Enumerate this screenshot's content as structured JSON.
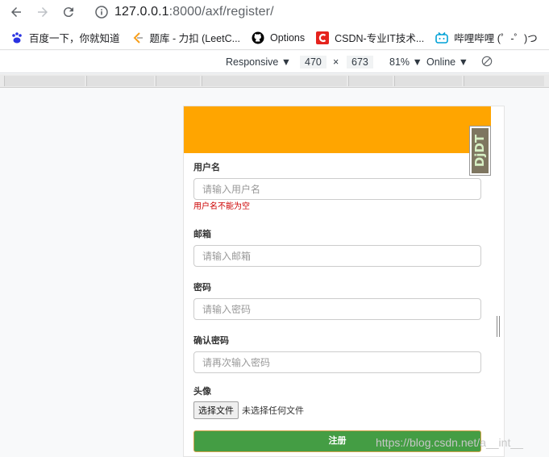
{
  "browser": {
    "url_host": "127.0.0.1",
    "url_rest": ":8000/axf/register/",
    "icons": {
      "back": "back-arrow-icon",
      "forward": "forward-arrow-icon",
      "reload": "reload-icon",
      "info": "info-icon"
    }
  },
  "bookmarks": [
    {
      "label": "百度一下，你就知道",
      "icon": "baidu-paw-icon",
      "color": "#2932e1"
    },
    {
      "label": "题库 - 力扣 (LeetC...",
      "icon": "leetcode-icon",
      "color": "#f89f1b"
    },
    {
      "label": "Options",
      "icon": "github-icon",
      "color": "#000000"
    },
    {
      "label": "CSDN-专业IT技术...",
      "icon": "csdn-icon",
      "color": "#e5231d"
    },
    {
      "label": "哔哩哔哩 (゜-゜)つ",
      "icon": "bilibili-icon",
      "color": "#00a1d6"
    }
  ],
  "device_toolbar": {
    "mode": "Responsive ▼",
    "width": "470",
    "times": "×",
    "height": "673",
    "zoom": "81% ▼",
    "network": "Online ▼"
  },
  "form": {
    "username_label": "用户名",
    "username_placeholder": "请输入用户名",
    "username_error": "用户名不能为空",
    "email_label": "邮箱",
    "email_placeholder": "请输入邮箱",
    "password_label": "密码",
    "password_placeholder": "请输入密码",
    "confirm_label": "确认密码",
    "confirm_placeholder": "请再次输入密码",
    "avatar_label": "头像",
    "file_button": "选择文件",
    "file_status": "未选择任何文件",
    "submit_label": "注册"
  },
  "debug_toolbar_handle": "DjDT",
  "watermark": "https://blog.csdn.net/a__int__",
  "colors": {
    "header": "#ffa500",
    "submit": "#449d44",
    "error": "#cc0000"
  }
}
